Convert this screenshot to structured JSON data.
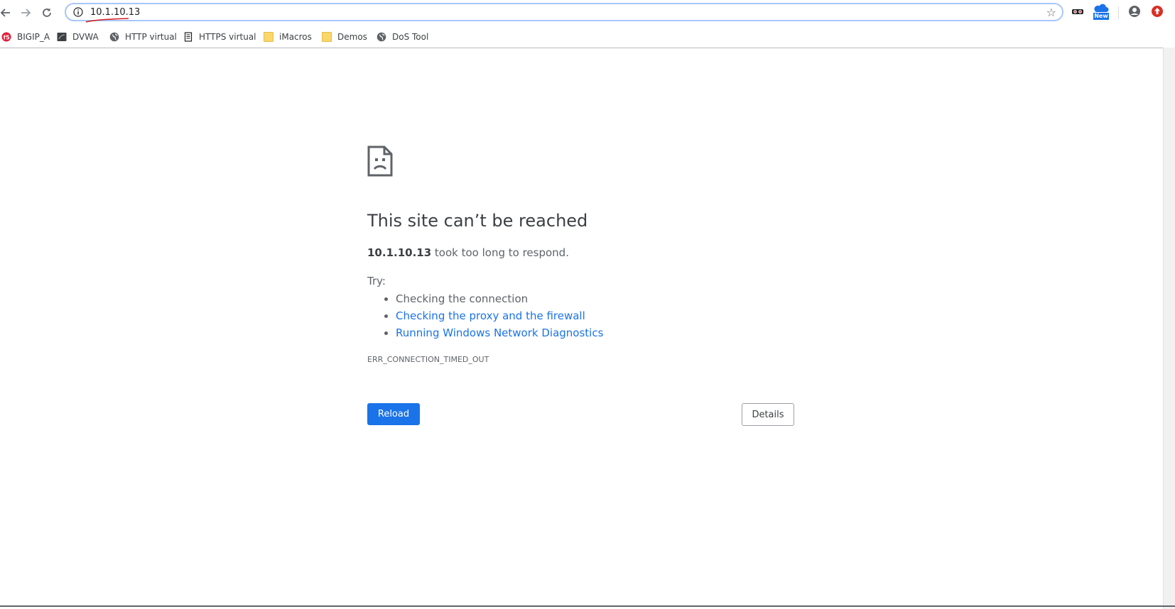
{
  "toolbar": {
    "back_icon": "back-arrow-icon",
    "forward_icon": "forward-arrow-icon",
    "reload_icon": "reload-icon",
    "url": "10.1.10.13",
    "site_info_icon": "info-icon",
    "bookmark_star_icon": "star-icon"
  },
  "bookmarks": [
    {
      "label": "BIGIP_A",
      "icon": "f5-logo-icon"
    },
    {
      "label": "DVWA",
      "icon": "dvwa-icon"
    },
    {
      "label": "HTTP virtual",
      "icon": "globe-icon"
    },
    {
      "label": "HTTPS virtual",
      "icon": "page-icon"
    },
    {
      "label": "iMacros",
      "icon": "folder-icon"
    },
    {
      "label": "Demos",
      "icon": "folder-icon"
    },
    {
      "label": "DoS Tool",
      "icon": "globe-icon"
    }
  ],
  "extensions": {
    "new_badge": "New"
  },
  "error_page": {
    "title": "This site can’t be reached",
    "host": "10.1.10.13",
    "message_suffix": " took too long to respond.",
    "try_label": "Try:",
    "suggestions": [
      "Checking the connection",
      "Checking the proxy and the firewall",
      "Running Windows Network Diagnostics"
    ],
    "error_code": "ERR_CONNECTION_TIMED_OUT",
    "reload_label": "Reload",
    "details_label": "Details"
  },
  "colors": {
    "accent": "#1a73e8",
    "text": "#5f6368",
    "heading": "#3c4043"
  }
}
